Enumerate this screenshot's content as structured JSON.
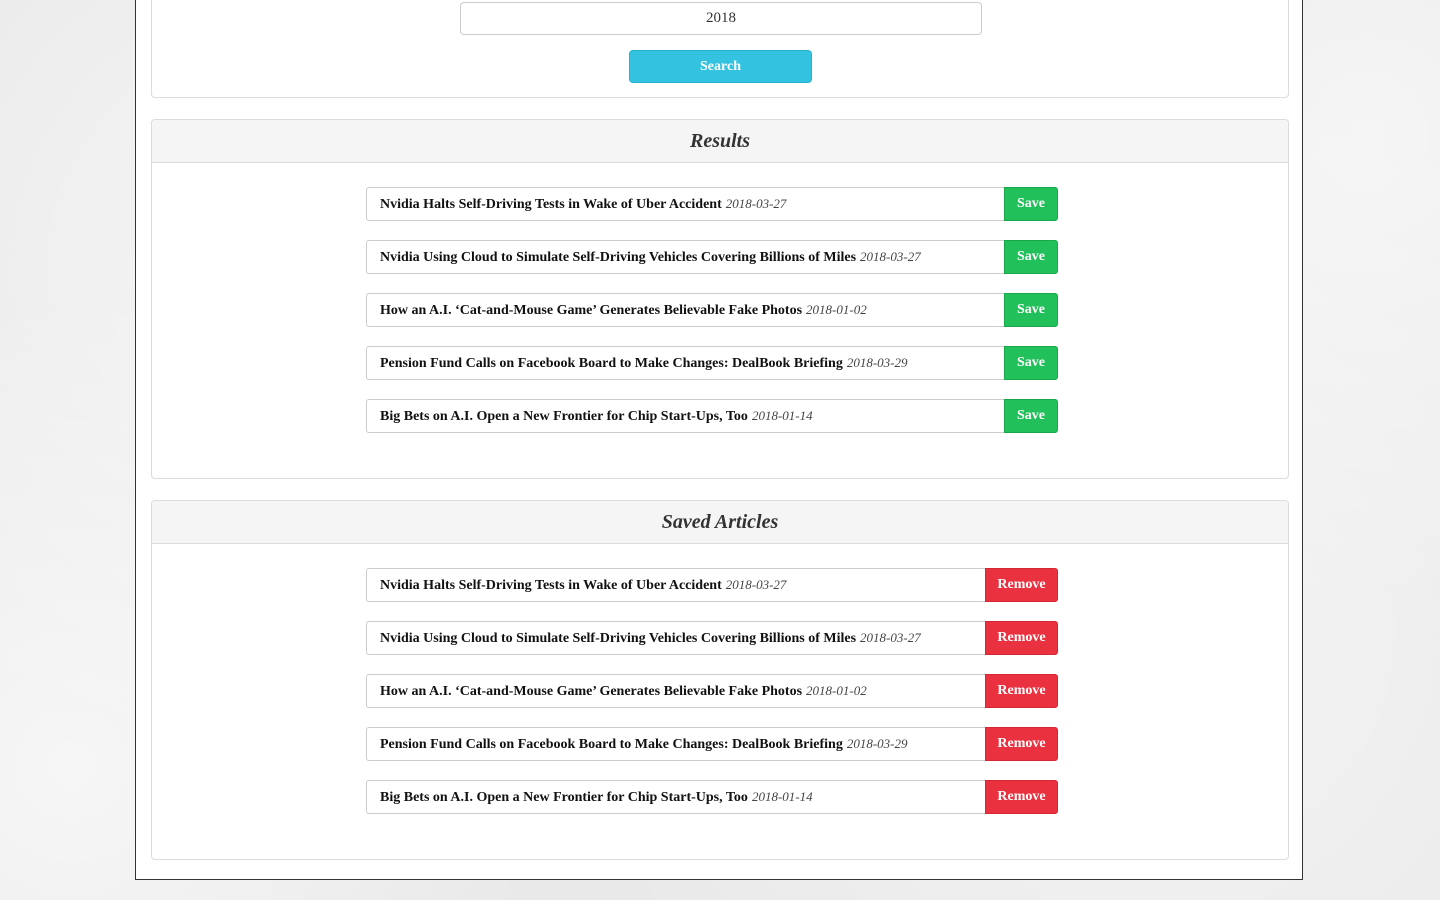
{
  "search": {
    "year_value": "2018",
    "button_label": "Search"
  },
  "results": {
    "title": "Results",
    "button_label": "Save",
    "items": [
      {
        "title": "Nvidia Halts Self-Driving Tests in Wake of Uber Accident",
        "date": "2018-03-27"
      },
      {
        "title": "Nvidia Using Cloud to Simulate Self-Driving Vehicles Covering Billions of Miles",
        "date": "2018-03-27"
      },
      {
        "title": "How an A.I. ‘Cat-and-Mouse Game’ Generates Believable Fake Photos",
        "date": "2018-01-02"
      },
      {
        "title": "Pension Fund Calls on Facebook Board to Make Changes: DealBook Briefing",
        "date": "2018-03-29"
      },
      {
        "title": "Big Bets on A.I. Open a New Frontier for Chip Start-Ups, Too",
        "date": "2018-01-14"
      }
    ]
  },
  "saved": {
    "title": "Saved Articles",
    "button_label": "Remove",
    "items": [
      {
        "title": "Nvidia Halts Self-Driving Tests in Wake of Uber Accident",
        "date": "2018-03-27"
      },
      {
        "title": "Nvidia Using Cloud to Simulate Self-Driving Vehicles Covering Billions of Miles",
        "date": "2018-03-27"
      },
      {
        "title": "How an A.I. ‘Cat-and-Mouse Game’ Generates Believable Fake Photos",
        "date": "2018-01-02"
      },
      {
        "title": "Pension Fund Calls on Facebook Board to Make Changes: DealBook Briefing",
        "date": "2018-03-29"
      },
      {
        "title": "Big Bets on A.I. Open a New Frontier for Chip Start-Ups, Too",
        "date": "2018-01-14"
      }
    ]
  },
  "colors": {
    "search_button": "#33c3e0",
    "save_button": "#22c05a",
    "remove_button": "#e9313f"
  }
}
